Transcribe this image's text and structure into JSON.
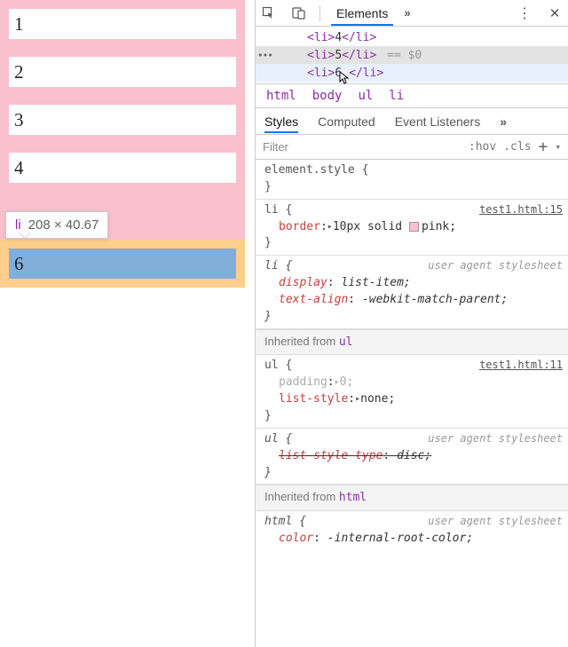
{
  "page": {
    "items": [
      "1",
      "2",
      "3",
      "4"
    ],
    "highlight_value": "6",
    "tooltip_tag": "li",
    "tooltip_dims": "208 × 40.67"
  },
  "tabs": {
    "elements": "Elements",
    "more": "»"
  },
  "dom": {
    "line4": {
      "open": "<li>",
      "text": "4",
      "close": "</li>"
    },
    "line5": {
      "open": "<li>",
      "text": "5",
      "close": "</li>",
      "eq": " == $0"
    },
    "line6": {
      "open": "<li>",
      "text": "6",
      "close": "</li>"
    }
  },
  "breadcrumb": [
    "html",
    "body",
    "ul",
    "li"
  ],
  "styles_tabs": {
    "styles": "Styles",
    "computed": "Computed",
    "events": "Event Listeners",
    "more": "»"
  },
  "filter": {
    "placeholder": "Filter",
    "hov": ":hov",
    "cls": ".cls"
  },
  "rules": {
    "element": {
      "selector_open": "element.style {",
      "close": "}"
    },
    "li": {
      "selector": "li {",
      "source": "test1.html:15",
      "prop_name": "border",
      "prop_val": "10px solid",
      "swatch_label": "pink;",
      "close": "}"
    },
    "li_ua": {
      "selector": "li {",
      "source": "user agent stylesheet",
      "display_name": "display",
      "display_val": "list-item;",
      "ta_name": "text-align",
      "ta_val": "-webkit-match-parent;",
      "close": "}"
    },
    "inherited_ul": {
      "label": "Inherited from",
      "tag": "ul"
    },
    "ul": {
      "selector": "ul {",
      "source": "test1.html:11",
      "padding_name": "padding",
      "padding_val": "0;",
      "ls_name": "list-style",
      "ls_val": "none;",
      "close": "}"
    },
    "ul_ua": {
      "selector": "ul {",
      "source": "user agent stylesheet",
      "lst_name": "list-style-type",
      "lst_val": "disc;",
      "close": "}"
    },
    "inherited_html": {
      "label": "Inherited from",
      "tag": "html"
    },
    "html_ua": {
      "selector": "html {",
      "source": "user agent stylesheet",
      "color_name": "color",
      "color_val": "-internal-root-color;"
    }
  }
}
